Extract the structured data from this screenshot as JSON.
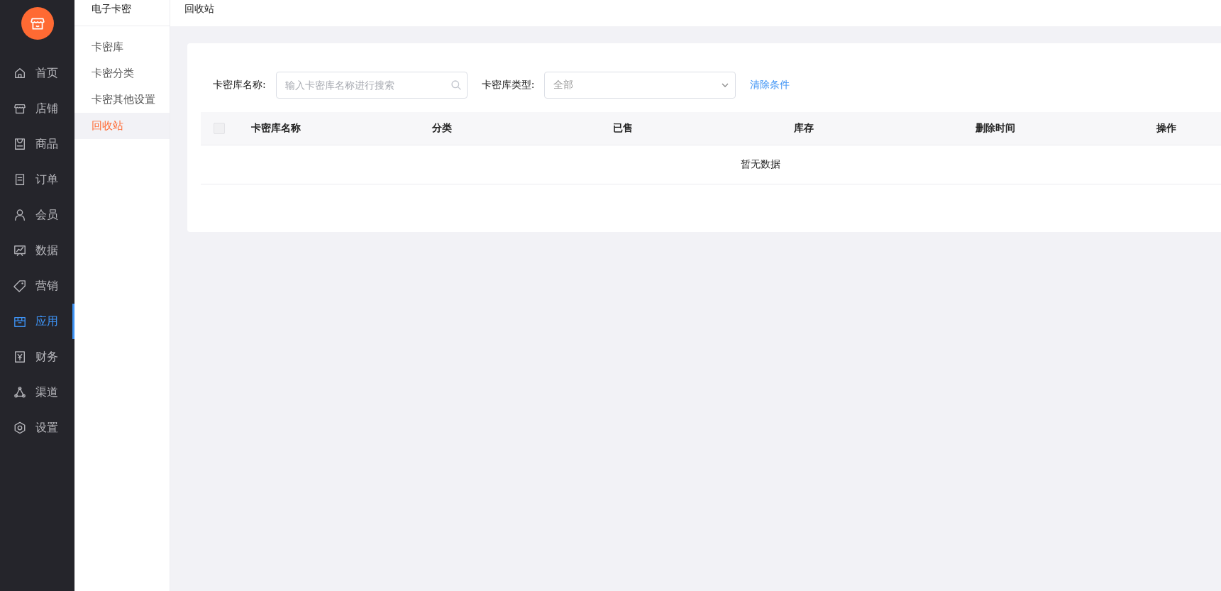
{
  "nav": [
    {
      "label": "首页",
      "selected": false
    },
    {
      "label": "店铺",
      "selected": false
    },
    {
      "label": "商品",
      "selected": false
    },
    {
      "label": "订单",
      "selected": false
    },
    {
      "label": "会员",
      "selected": false
    },
    {
      "label": "数据",
      "selected": false
    },
    {
      "label": "营销",
      "selected": false
    },
    {
      "label": "应用",
      "selected": true
    },
    {
      "label": "财务",
      "selected": false
    },
    {
      "label": "渠道",
      "selected": false
    },
    {
      "label": "设置",
      "selected": false
    }
  ],
  "subnav": {
    "title": "电子卡密",
    "items": [
      {
        "label": "卡密库",
        "selected": false
      },
      {
        "label": "卡密分类",
        "selected": false
      },
      {
        "label": "卡密其他设置",
        "selected": false
      },
      {
        "label": "回收站",
        "selected": true
      }
    ]
  },
  "page_title": "回收站",
  "filters": {
    "name_label": "卡密库名称:",
    "name_placeholder": "输入卡密库名称进行搜索",
    "type_label": "卡密库类型:",
    "type_value": "全部",
    "clear_link": "清除条件"
  },
  "table": {
    "select_all": {
      "checked": false
    },
    "columns": [
      "卡密库名称",
      "分类",
      "已售",
      "库存",
      "删除时间",
      "操作"
    ],
    "empty_text": "暂无数据"
  }
}
